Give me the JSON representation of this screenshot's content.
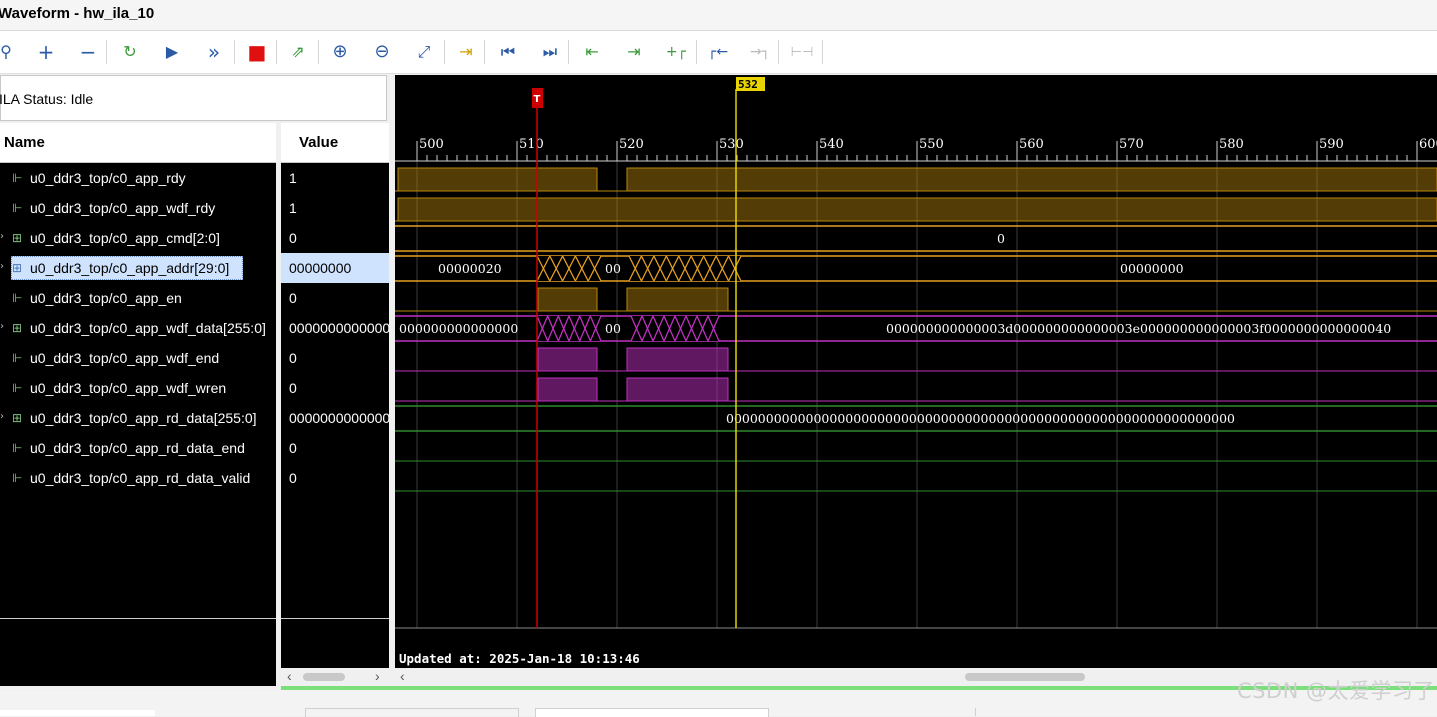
{
  "window": {
    "title": "Waveform - hw_ila_10"
  },
  "toolbar": {
    "buttons": [
      {
        "name": "search",
        "glyph": "⚲"
      },
      {
        "name": "add",
        "glyph": "+"
      },
      {
        "name": "remove",
        "glyph": "−"
      },
      {
        "name": "run-trigger-immediate",
        "glyph": "↻"
      },
      {
        "name": "run-trigger",
        "glyph": "▶"
      },
      {
        "name": "run-continuous",
        "glyph": "»"
      },
      {
        "name": "stop",
        "glyph": "■"
      },
      {
        "name": "export",
        "glyph": "⇗"
      },
      {
        "name": "zoom-in",
        "glyph": "⊕"
      },
      {
        "name": "zoom-out",
        "glyph": "⊖"
      },
      {
        "name": "zoom-fit",
        "glyph": "⤢"
      },
      {
        "name": "add-marker",
        "glyph": "⇥"
      },
      {
        "name": "go-to-start",
        "glyph": "⏮"
      },
      {
        "name": "go-to-end",
        "glyph": "⏭"
      },
      {
        "name": "previous-transition",
        "glyph": "⇤"
      },
      {
        "name": "next-transition",
        "glyph": "⇥"
      },
      {
        "name": "add-marker-2",
        "glyph": "+┌"
      },
      {
        "name": "previous-marker",
        "glyph": "┌←"
      },
      {
        "name": "next-marker",
        "glyph": "→┐"
      },
      {
        "name": "swap-cursors",
        "glyph": "⊢⊣"
      }
    ]
  },
  "status": {
    "text": "ILA Status:  Idle"
  },
  "columns": {
    "name": "Name",
    "value": "Value"
  },
  "signals": [
    {
      "name": "u0_ddr3_top/c0_app_rdy",
      "value": "1",
      "kind": "bit"
    },
    {
      "name": "u0_ddr3_top/c0_app_wdf_rdy",
      "value": "1",
      "kind": "bit"
    },
    {
      "name": "u0_ddr3_top/c0_app_cmd[2:0]",
      "value": "0",
      "kind": "bus"
    },
    {
      "name": "u0_ddr3_top/c0_app_addr[29:0]",
      "value": "00000000",
      "kind": "bus",
      "selected": true
    },
    {
      "name": "u0_ddr3_top/c0_app_en",
      "value": "0",
      "kind": "bit"
    },
    {
      "name": "u0_ddr3_top/c0_app_wdf_data[255:0]",
      "value": "0000000000000",
      "kind": "bus"
    },
    {
      "name": "u0_ddr3_top/c0_app_wdf_end",
      "value": "0",
      "kind": "bit"
    },
    {
      "name": "u0_ddr3_top/c0_app_wdf_wren",
      "value": "0",
      "kind": "bit"
    },
    {
      "name": "u0_ddr3_top/c0_app_rd_data[255:0]",
      "value": "0000000000000",
      "kind": "bus"
    },
    {
      "name": "u0_ddr3_top/c0_app_rd_data_end",
      "value": "0",
      "kind": "bit"
    },
    {
      "name": "u0_ddr3_top/c0_app_rd_data_valid",
      "value": "0",
      "kind": "bit"
    }
  ],
  "waveform": {
    "timeline": {
      "start": 500,
      "end": 600,
      "labels": [
        500,
        510,
        520,
        530,
        540,
        550,
        560,
        570,
        580,
        590,
        600
      ]
    },
    "trigger": {
      "label": "T",
      "time": 512,
      "color": "#cc0000"
    },
    "cursor": {
      "label": "532",
      "time": 532,
      "color": "#e8d400"
    },
    "bus_labels": {
      "cmd": "0",
      "addr_before": "00000020",
      "addr_mid": "00",
      "addr_after": "00000000",
      "wdf_data_before": "000000000000000",
      "wdf_data_mid": "00",
      "wdf_data_after": "000000000000003d000000000000003e000000000000003f0000000000000040",
      "rd_data": "0000000000000000000000000000000000000000000000000000000000000000"
    },
    "updated": "Updated at: 2025-Jan-18 10:13:46"
  },
  "colors": {
    "bit_high": "#b8860b",
    "bus": "#e6a020",
    "wdf": "#c030c0",
    "rd": "#2e8b2e",
    "cursor": "#e8d400",
    "trigger": "#cc0000"
  },
  "watermark": "CSDN @太爱学习了"
}
